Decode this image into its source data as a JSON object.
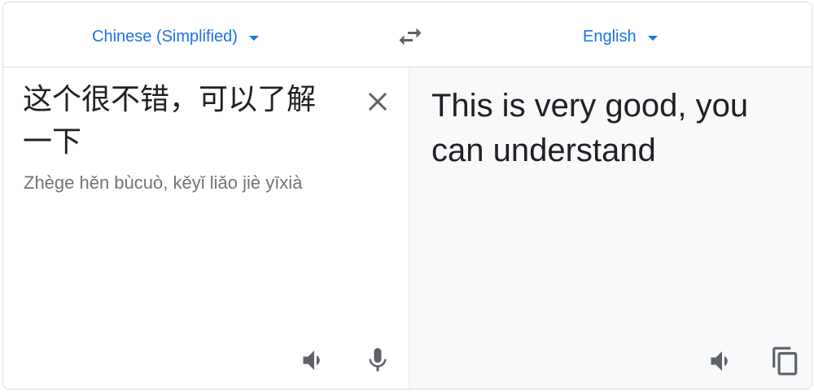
{
  "lang_bar": {
    "source_language": "Chinese (Simplified)",
    "target_language": "English",
    "swap_icon": "swap-horiz-icon"
  },
  "source": {
    "text": "这个很不错，可以了解一下",
    "romanization": "Zhège hěn bùcuò, kěyǐ liǎo jiè yīxià",
    "clear_icon": "close-icon",
    "listen_icon": "volume-icon",
    "mic_icon": "microphone-icon"
  },
  "target": {
    "text": "This is very good, you can understand",
    "listen_icon": "volume-icon",
    "copy_icon": "copy-icon"
  },
  "colors": {
    "accent": "#1a73e8",
    "icon": "#5f6368",
    "text": "#202124",
    "muted": "#70757a",
    "target_bg": "#f8f9fa",
    "border": "#dadce0"
  }
}
